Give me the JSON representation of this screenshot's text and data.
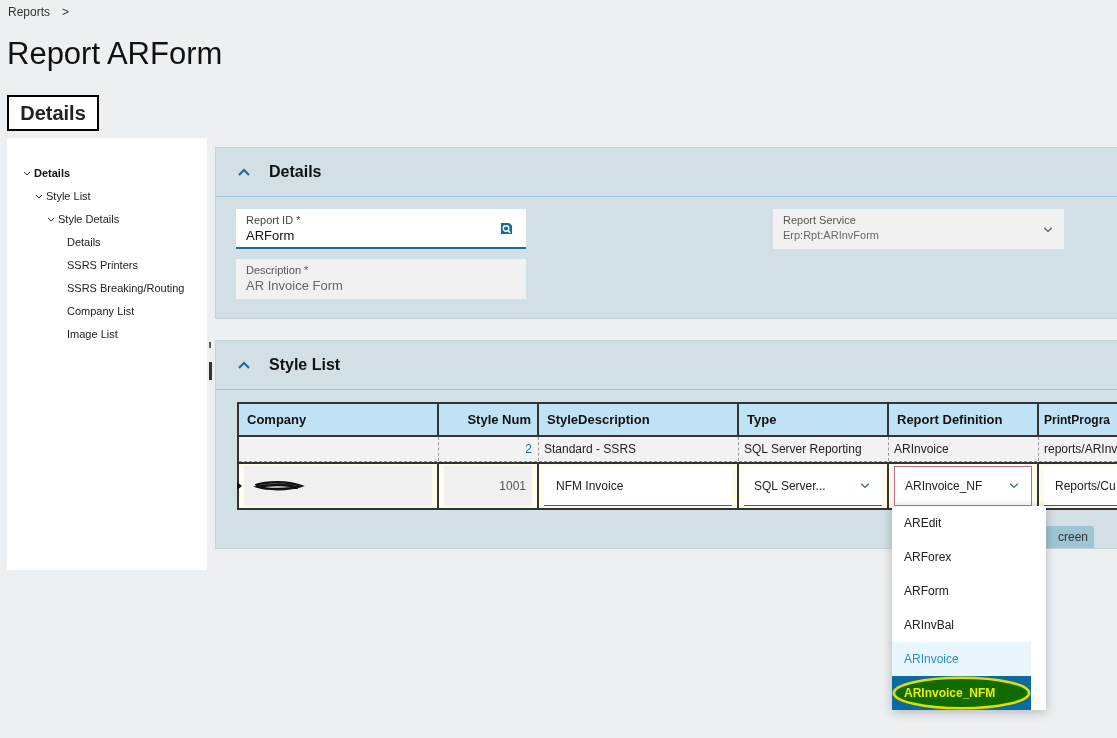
{
  "breadcrumb": [
    {
      "label": "Reports",
      "separator": ">"
    }
  ],
  "page_title": "Report ARForm",
  "tab": {
    "label": "Details",
    "selected": true
  },
  "tree": [
    {
      "label": "Details",
      "bold": true,
      "expanded": true,
      "children": [
        {
          "label": "Style List",
          "expanded": true,
          "children": [
            {
              "label": "Style Details",
              "expanded": true,
              "children": [
                {
                  "label": "Details"
                },
                {
                  "label": "SSRS Printers"
                },
                {
                  "label": "SSRS Breaking/Routing"
                },
                {
                  "label": "Company List"
                },
                {
                  "label": "Image List"
                }
              ]
            }
          ]
        }
      ]
    }
  ],
  "details_panel": {
    "title": "Details",
    "expanded": true,
    "fields": [
      {
        "label": "Report ID *",
        "value": "ARForm",
        "kind": "search",
        "disabled": false
      },
      {
        "label": "Report Service",
        "value": "Erp:Rpt:ARInvForm",
        "kind": "dropdown",
        "disabled": true
      },
      {
        "label": "Description *",
        "value": "AR Invoice Form",
        "kind": "text",
        "disabled": true
      }
    ]
  },
  "style_list_panel": {
    "title": "Style List",
    "expanded": true,
    "table": {
      "columns": [
        "Company",
        "Style Num",
        "StyleDescription",
        "Type",
        "Report Definition",
        "PrintProgra"
      ],
      "rows": [
        {
          "editing": false,
          "cells": [
            "",
            "2",
            "Standard - SSRS",
            "SQL Server Reporting",
            "ARInvoice",
            "reports/ARInv"
          ]
        },
        {
          "editing": true,
          "cells": [
            "",
            "1001",
            "NFM Invoice",
            "SQL Server...",
            "ARInvoice_NF",
            "Reports/Cu"
          ]
        }
      ]
    },
    "button": "creen"
  },
  "dropdown": {
    "options": [
      {
        "label": "AREdit",
        "selected": false
      },
      {
        "label": "ARForex",
        "selected": false
      },
      {
        "label": "ARForm",
        "selected": false
      },
      {
        "label": "ARInvBal",
        "selected": false
      },
      {
        "label": "ARInvoice",
        "selected": false,
        "hovered": true
      },
      {
        "label": "ARInvoice_NFM",
        "selected": true,
        "highlighted": true
      }
    ]
  }
}
